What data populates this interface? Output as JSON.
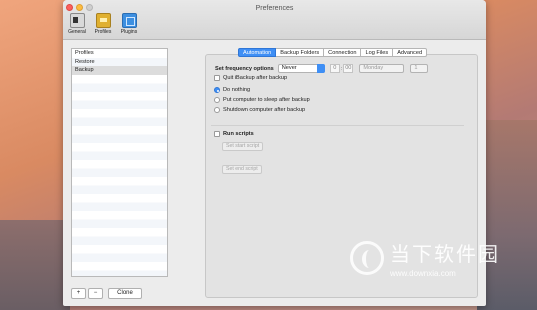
{
  "window": {
    "title": "Preferences"
  },
  "toolbar": {
    "items": [
      {
        "label": "General",
        "icon": "general-icon"
      },
      {
        "label": "Profiles",
        "icon": "profiles-icon"
      },
      {
        "label": "Plugins",
        "icon": "plugins-icon"
      }
    ]
  },
  "profiles": {
    "items": [
      "Profiles",
      "Restore",
      "Backup"
    ],
    "selected": "Backup"
  },
  "list_buttons": {
    "add": "+",
    "remove": "−",
    "clone": "Clone"
  },
  "tabs": [
    {
      "label": "Automation",
      "active": true
    },
    {
      "label": "Backup Folders",
      "active": false
    },
    {
      "label": "Connection",
      "active": false
    },
    {
      "label": "Log Files",
      "active": false
    },
    {
      "label": "Advanced",
      "active": false
    }
  ],
  "automation": {
    "frequency_label": "Set frequency options",
    "frequency_value": "Never",
    "hour": "0",
    "minute": "00",
    "weekday": "Monday",
    "day": "1",
    "quit_label": "Quit iBackup after backup",
    "after_options": [
      {
        "label": "Do nothing",
        "selected": true
      },
      {
        "label": "Put computer to sleep after backup",
        "selected": false
      },
      {
        "label": "Shutdown computer after backup",
        "selected": false
      }
    ],
    "run_scripts_label": "Run scripts",
    "start_script_btn": "Set start script",
    "end_script_btn": "Set end script"
  },
  "watermark": {
    "text": "当下软件园",
    "url": "www.downxia.com"
  },
  "colors": {
    "accent": "#3f8ff5",
    "close": "#fc605c",
    "minimize": "#fdbc40"
  }
}
